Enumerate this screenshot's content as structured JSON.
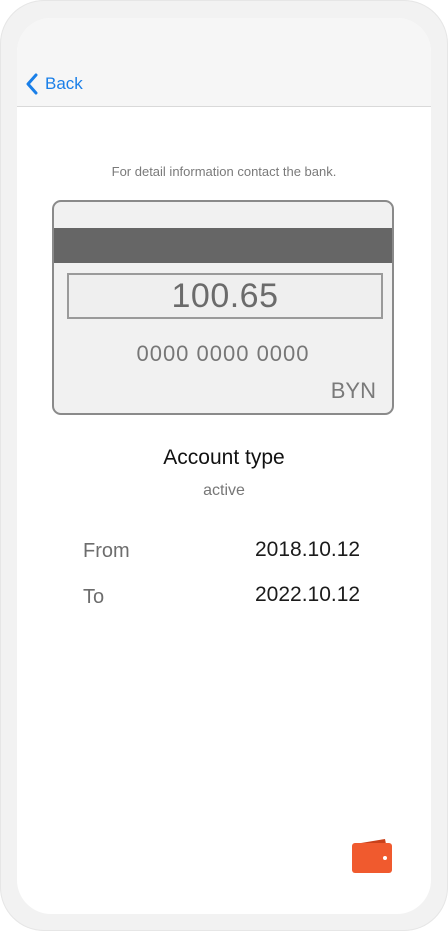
{
  "nav": {
    "back_label": "Back"
  },
  "info": {
    "hint": "For detail information contact the bank."
  },
  "card": {
    "balance": "100.65",
    "number": "0000 0000 0000",
    "currency": "BYN"
  },
  "account": {
    "type_label": "Account type",
    "status": "active"
  },
  "validity": {
    "from_label": "From",
    "from_value": "2018.10.12",
    "to_label": "To",
    "to_value": "2022.10.12"
  },
  "icons": {
    "back": "chevron-left-icon",
    "wallet": "wallet-icon"
  },
  "colors": {
    "accent": "#1a7fe8",
    "wallet": "#f05a2e"
  }
}
